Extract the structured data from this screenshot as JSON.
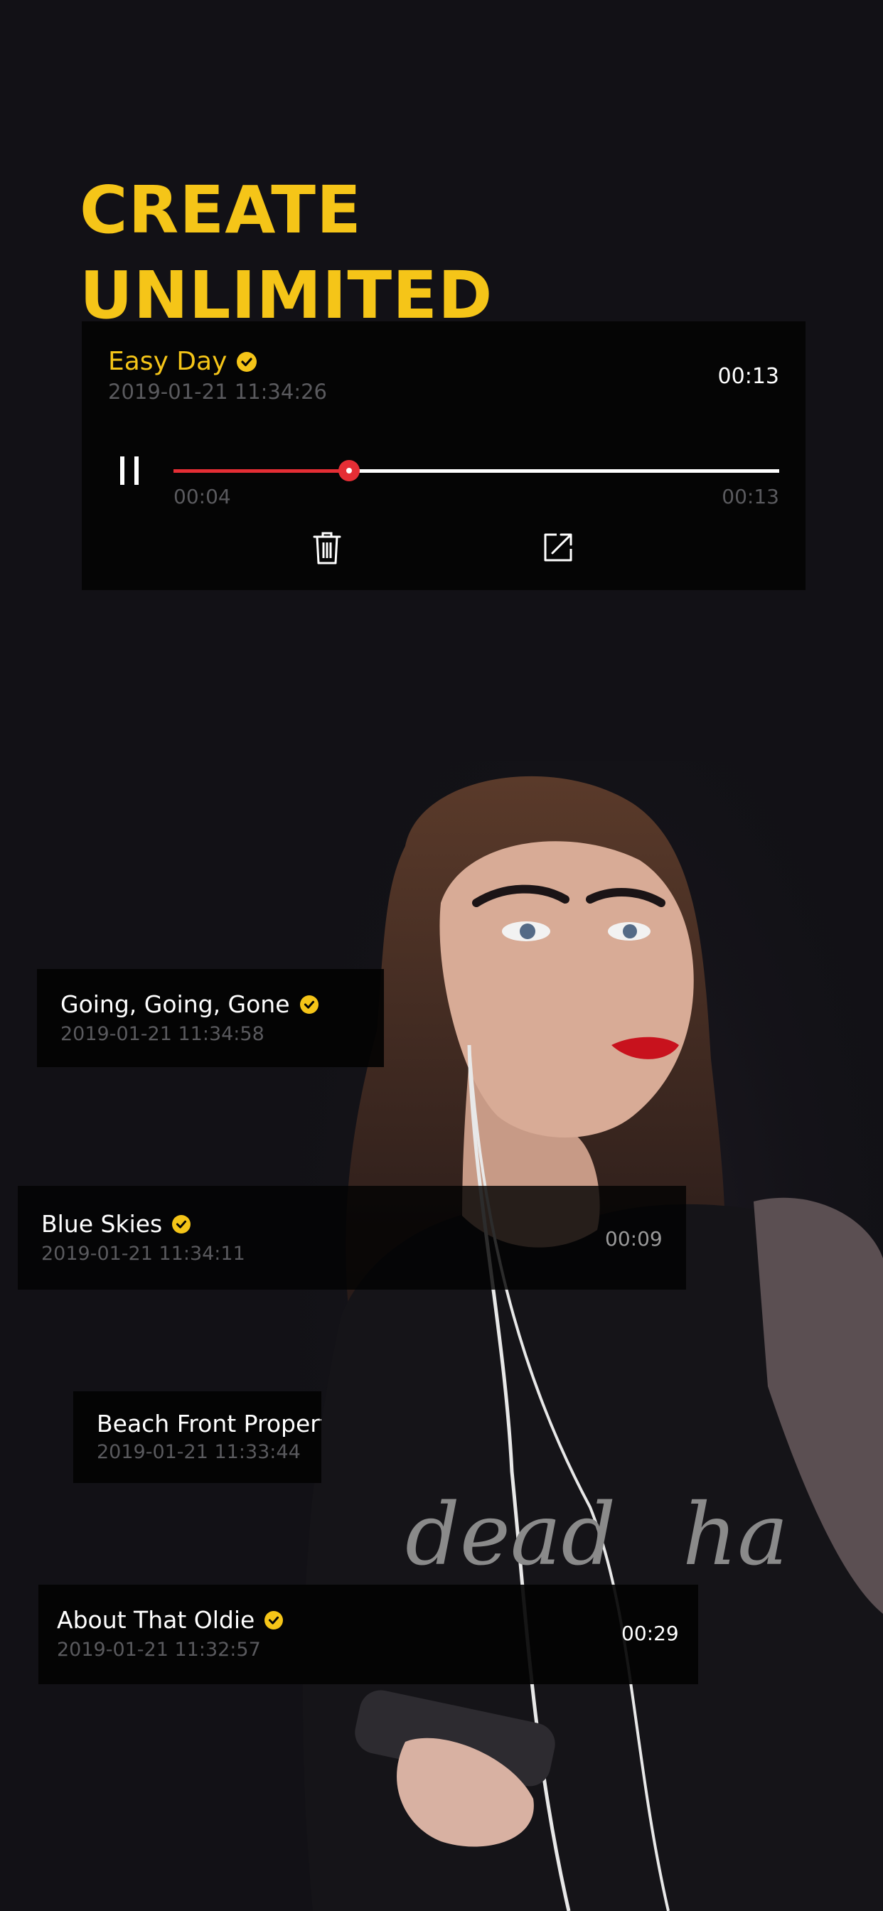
{
  "headline": {
    "line1": "CREATE",
    "line2": "UNLIMITED RINGTONES"
  },
  "player": {
    "title": "Easy Day",
    "date": "2019-01-21 11:34:26",
    "duration": "00:13",
    "current_time": "00:04",
    "total_time": "00:13",
    "progress": 0.29,
    "icons": {
      "pause": "pause-icon",
      "delete": "trash-icon",
      "share": "share-icon",
      "verified": "verified-check-icon"
    }
  },
  "ringtones": [
    {
      "title": "Going, Going, Gone",
      "date": "2019-01-21 11:34:58",
      "duration": ""
    },
    {
      "title": "Blue Skies",
      "date": "2019-01-21 11:34:11",
      "duration": "00:09"
    },
    {
      "title": "Beach Front Property",
      "date": "2019-01-21 11:33:44",
      "duration": ""
    },
    {
      "title": "About That Oldie",
      "date": "2019-01-21 11:32:57",
      "duration": "00:29"
    }
  ],
  "colors": {
    "accent": "#f5c518",
    "progress": "#e52e35",
    "background": "#121116",
    "card": "#050505",
    "muted_text": "#5a5a5e"
  }
}
